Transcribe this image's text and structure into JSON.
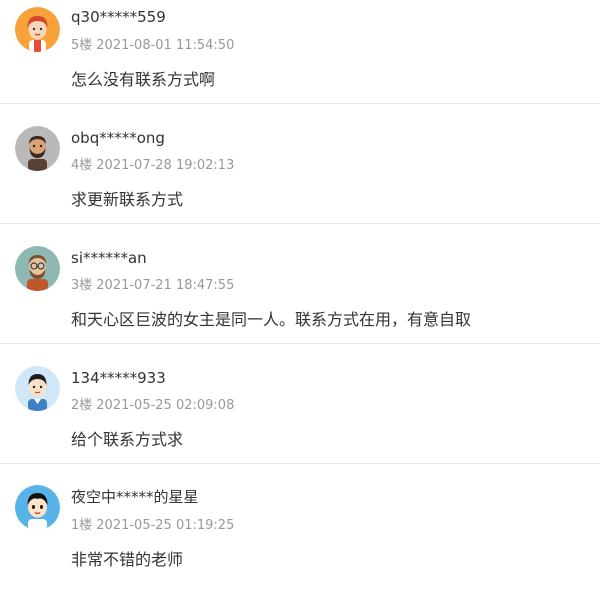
{
  "comments": [
    {
      "user": "q30*****559",
      "floor": "5楼",
      "time": "2021-08-01 11:54:50",
      "text": "怎么没有联系方式啊",
      "avatar_icon": "cartoon-man-red-hair-avatar-icon"
    },
    {
      "user": "obq*****ong",
      "floor": "4楼",
      "time": "2021-07-28 19:02:13",
      "text": "求更新联系方式",
      "avatar_icon": "cartoon-man-beard-avatar-icon"
    },
    {
      "user": "si******an",
      "floor": "3楼",
      "time": "2021-07-21 18:47:55",
      "text": "和天心区巨波的女主是同一人。联系方式在用，有意自取",
      "avatar_icon": "cartoon-man-glasses-beard-avatar-icon"
    },
    {
      "user": "134*****933",
      "floor": "2楼",
      "time": "2021-05-25 02:09:08",
      "text": "给个联系方式求",
      "avatar_icon": "cartoon-man-black-hair-avatar-icon"
    },
    {
      "user": "夜空中*****的星星",
      "floor": "1楼",
      "time": "2021-05-25 01:19:25",
      "text": "非常不错的老师",
      "avatar_icon": "cartoon-boy-avatar-icon"
    }
  ],
  "colors": {
    "username": "#333333",
    "meta": "#999999",
    "content": "#333333",
    "divider": "#e8e8e8"
  }
}
